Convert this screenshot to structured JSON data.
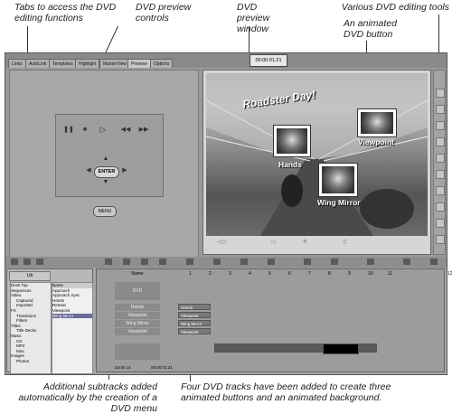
{
  "callouts": {
    "tabs": "Tabs to access the DVD editing functions",
    "preview_controls": "DVD preview controls",
    "preview_window": "DVD preview window",
    "editing_tools": "Various DVD editing tools",
    "animated_button": "An animated DVD button",
    "subtracks": "Additional subtracks added automatically by the creation of a DVD menu",
    "four_tracks": "Four DVD tracks have been added to create three animated buttons and an animated background."
  },
  "tabs": [
    "Links",
    "AutoLink",
    "Templates",
    "Highlight",
    "MasterView",
    "Preview",
    "Options"
  ],
  "active_tab": "Preview",
  "timecode_top": "00:00:01:21",
  "controls": {
    "enter_label": "ENTER",
    "menu_label": "MENU"
  },
  "preview": {
    "title_text": "Roadster Day!",
    "buttons": [
      "Hands",
      "Viewpoint",
      "Wing Mirror"
    ]
  },
  "library": {
    "tab_label": "Lib",
    "tree": [
      "Desk Top",
      "Sequences",
      "Video",
      "Captured",
      "Imported",
      "FX",
      "Transitions",
      "Filters",
      "Titles",
      "Title Decks",
      "Music",
      "CD",
      "MP3",
      "Misc",
      "Images",
      "Photos"
    ],
    "list_header": "Name",
    "list": [
      "Approach",
      "Approach Sync",
      "Hands",
      "Retreat",
      "Viewpoint",
      "Wing Mirror"
    ]
  },
  "timeline": {
    "name_header": "Name",
    "ruler": [
      "1",
      "2",
      "3",
      "4",
      "5",
      "6",
      "7",
      "8",
      "9",
      "10",
      "11",
      "12"
    ],
    "tracks": [
      "DVD",
      "Hands",
      "Viewpoint",
      "Wing Mirror",
      "Viewpoint"
    ],
    "clips": [
      "Hands",
      "Viewpoint",
      "Wing Mirror",
      "Viewpoint"
    ],
    "zoom_label": "Zoom 14",
    "timecode": "00:00:01:21"
  }
}
